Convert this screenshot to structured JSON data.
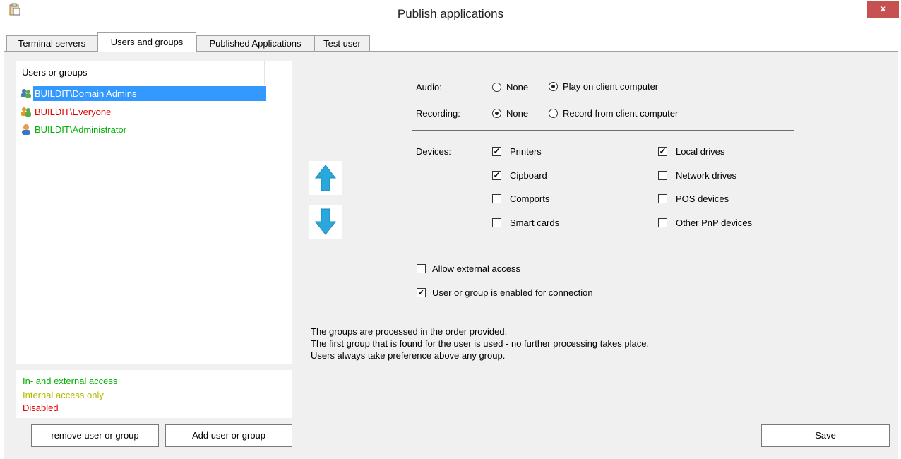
{
  "window": {
    "title": "Publish applications",
    "close_label": "×"
  },
  "tabs": [
    {
      "label": "Terminal servers"
    },
    {
      "label": "Users and groups"
    },
    {
      "label": "Published Applications"
    },
    {
      "label": "Test user"
    }
  ],
  "list": {
    "header": "Users or groups",
    "items": [
      {
        "label": "BUILDIT\\Domain Admins",
        "color": "#ffffff",
        "selected": true,
        "icon": "group-icon"
      },
      {
        "label": "BUILDIT\\Everyone",
        "color": "#e00000",
        "icon": "group-icon"
      },
      {
        "label": "BUILDIT\\Administrator",
        "color": "#00b000",
        "icon": "user-icon"
      }
    ]
  },
  "legend": {
    "green": {
      "label": "In- and external access",
      "color": "#00b000"
    },
    "yellow": {
      "label": "Internal access only",
      "color": "#b8b800"
    },
    "red": {
      "label": "Disabled",
      "color": "#e00000"
    }
  },
  "buttons": {
    "remove": "remove user or group",
    "add": "Add user or group",
    "save": "Save"
  },
  "audio": {
    "label": "Audio:",
    "options": [
      {
        "label": "None",
        "checked": false
      },
      {
        "label": "Play on client computer",
        "checked": true
      }
    ]
  },
  "recording": {
    "label": "Recording:",
    "options": [
      {
        "label": "None",
        "checked": true
      },
      {
        "label": "Record from client computer",
        "checked": false
      }
    ]
  },
  "devices": {
    "label": "Devices:",
    "items": [
      {
        "label": "Printers",
        "checked": true
      },
      {
        "label": "Local drives",
        "checked": true
      },
      {
        "label": "Cipboard",
        "checked": true
      },
      {
        "label": "Network drives",
        "checked": false
      },
      {
        "label": "Comports",
        "checked": false
      },
      {
        "label": "POS devices",
        "checked": false
      },
      {
        "label": "Smart cards",
        "checked": false
      },
      {
        "label": "Other PnP devices",
        "checked": false
      }
    ]
  },
  "options": {
    "external": {
      "label": "Allow external access",
      "checked": false
    },
    "enabled": {
      "label": "User or group is enabled for connection",
      "checked": true
    }
  },
  "notes": [
    "The groups are processed in the order provided.",
    "The first group that is found for the user is used - no further processing takes place.",
    "Users always take preference above any group."
  ],
  "arrows": {
    "up_icon": "arrow-up-icon",
    "down_icon": "arrow-down-icon",
    "color": "#2aa8dc"
  }
}
